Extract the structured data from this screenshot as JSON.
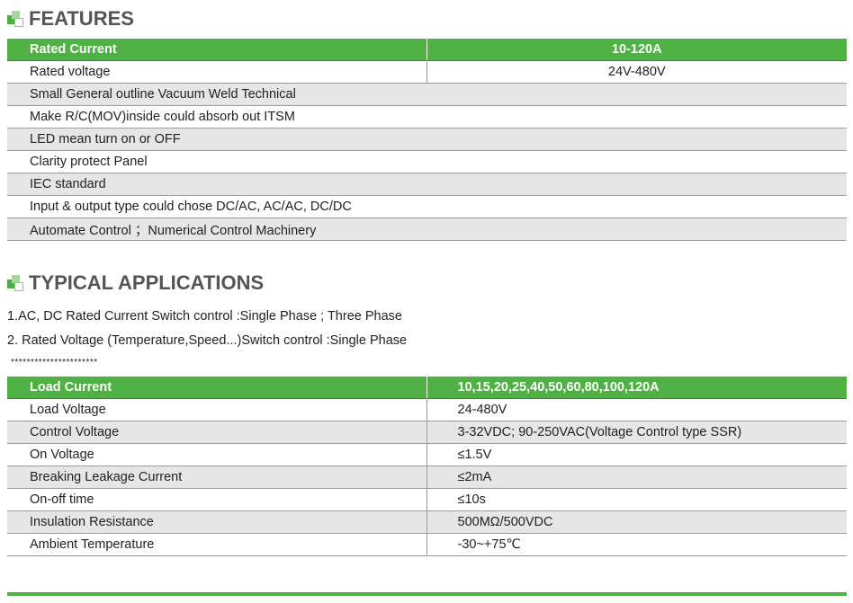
{
  "features": {
    "heading": "FEATURES",
    "header": {
      "label": "Rated Current",
      "value": "10-120A"
    },
    "rated_voltage": {
      "label": "Rated voltage",
      "value": "24V-480V"
    },
    "items": [
      "Small General outline Vacuum Weld Technical",
      "Make R/C(MOV)inside could absorb out ITSM",
      "LED mean turn on or OFF",
      "Clarity protect Panel",
      "IEC standard",
      "Input & output type could chose DC/AC, AC/AC, DC/DC",
      "Automate Control ；Numerical Control Machinery"
    ]
  },
  "applications": {
    "heading": "TYPICAL APPLICATIONS",
    "lines": [
      "1.AC, DC Rated Current  Switch control :Single Phase ; Three Phase",
      "2. Rated Voltage (Temperature,Speed...)Switch control :Single Phase"
    ],
    "separator": "**********************"
  },
  "load_table": {
    "header": {
      "label": "Load Current",
      "value": "10,15,20,25,40,50,60,80,100,120A"
    },
    "rows": [
      {
        "label": "Load Voltage",
        "value": "24-480V"
      },
      {
        "label": "Control Voltage",
        "value": "3-32VDC;  90-250VAC(Voltage Control type SSR)"
      },
      {
        "label": "On Voltage",
        "value": "≤1.5V"
      },
      {
        "label": "Breaking Leakage Current",
        "value": "≤2mA"
      },
      {
        "label": "On-off time",
        "value": "≤10s"
      },
      {
        "label": "Insulation Resistance",
        "value": "500MΩ/500VDC"
      },
      {
        "label": "Ambient Temperature",
        "value": "-30~+75℃"
      }
    ]
  },
  "colors": {
    "accent": "#4fb043",
    "row_gray": "#e6e6e6",
    "heading_text": "#555555"
  }
}
